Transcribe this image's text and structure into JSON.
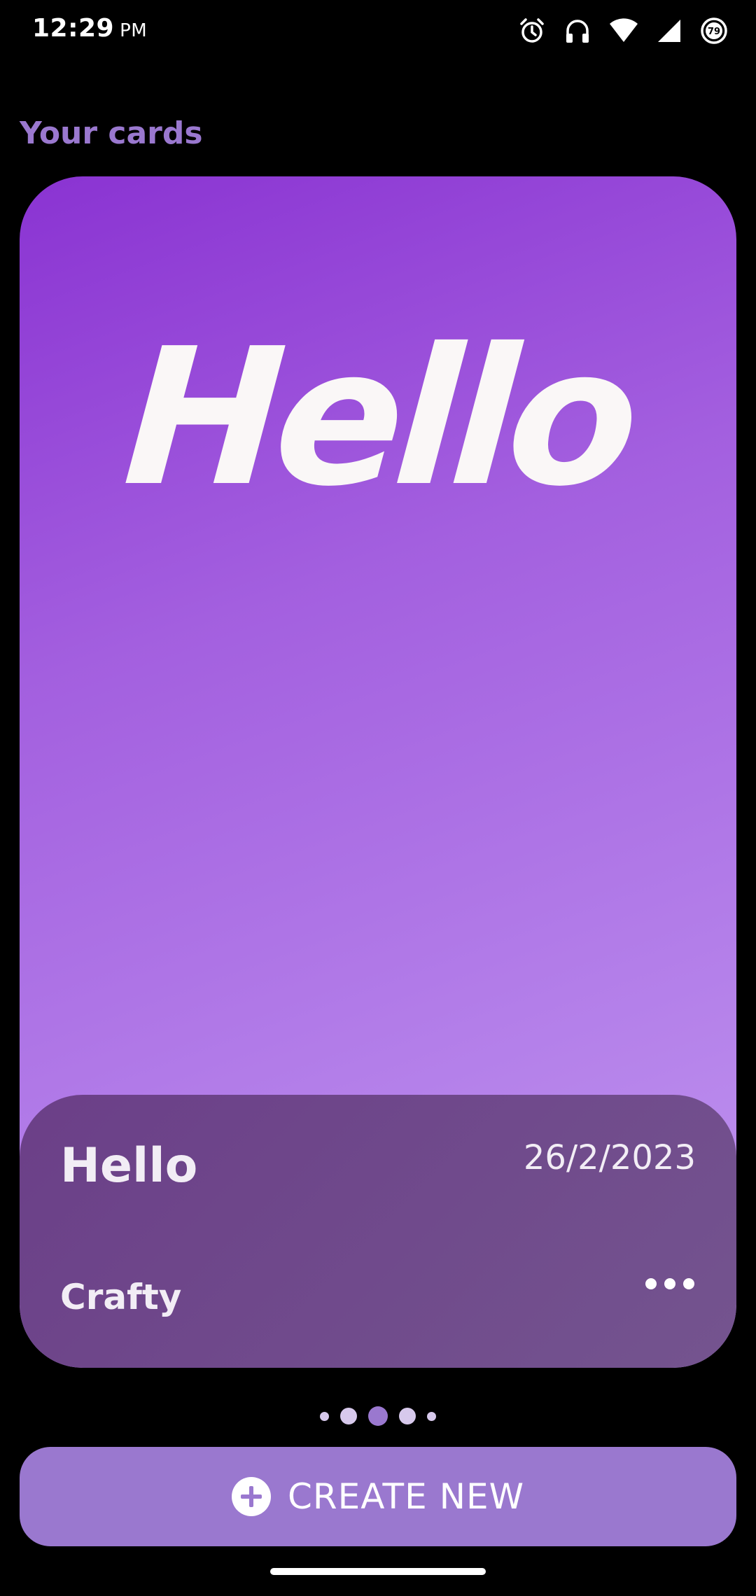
{
  "status_bar": {
    "time": "12:29",
    "ampm": "PM",
    "battery_level": "79",
    "icons": [
      "alarm-icon",
      "headphones-icon",
      "wifi-icon",
      "signal-icon",
      "battery-icon"
    ]
  },
  "section": {
    "title": "Your cards"
  },
  "card": {
    "art_text": "Hello",
    "name": "Hello",
    "date": "26/2/2023",
    "author": "Crafty",
    "more_icon": "more-horizontal-icon",
    "colors": {
      "gradient_start": "#8a33d2",
      "gradient_end": "#c197f0",
      "info_panel": "#6b3f88"
    }
  },
  "pager": {
    "count": 5,
    "active_index": 2
  },
  "actions": {
    "create_label": "CREATE NEW",
    "create_icon": "plus-circle-icon",
    "accent": "#9a78cf"
  }
}
